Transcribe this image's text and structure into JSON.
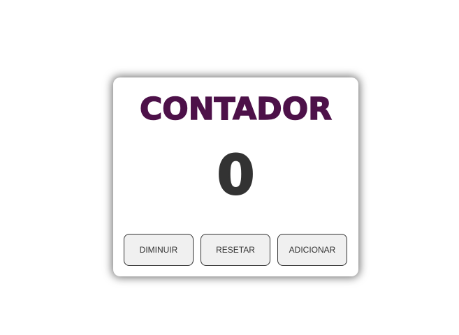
{
  "card": {
    "title": "CONTADOR",
    "count": "0"
  },
  "buttons": {
    "decrease_label": "DIMINUIR",
    "reset_label": "RESETAR",
    "increase_label": "ADICIONAR"
  },
  "colors": {
    "title": "#4d1149",
    "counter": "#333333",
    "button_bg": "#f0f0f0",
    "button_border": "#333333"
  }
}
